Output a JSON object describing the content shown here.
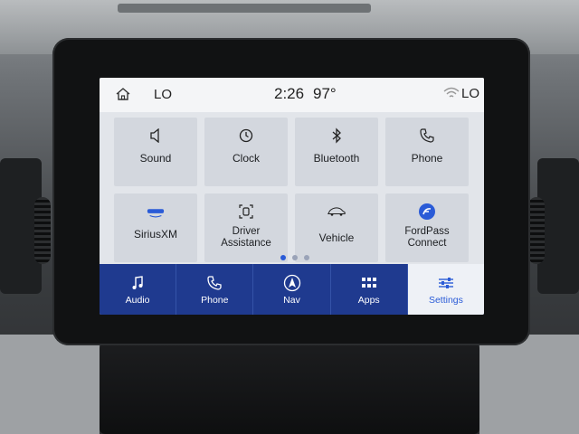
{
  "status": {
    "left_label": "LO",
    "time": "2:26",
    "temperature": "97°",
    "right_label": "LO"
  },
  "tiles": [
    {
      "label": "Sound",
      "icon": "speaker-icon"
    },
    {
      "label": "Clock",
      "icon": "clock-icon"
    },
    {
      "label": "Bluetooth",
      "icon": "bluetooth-icon"
    },
    {
      "label": "Phone",
      "icon": "phone-icon"
    },
    {
      "label": "SiriusXM",
      "icon": "siriusxm-icon"
    },
    {
      "label_line1": "Driver",
      "label_line2": "Assistance",
      "icon": "driver-assist-icon"
    },
    {
      "label": "Vehicle",
      "icon": "car-icon"
    },
    {
      "label_line1": "FordPass",
      "label_line2": "Connect",
      "icon": "fordpass-icon"
    }
  ],
  "page_dots": {
    "count": 3,
    "active": 0
  },
  "nav": [
    {
      "label": "Audio",
      "icon": "music-note-icon"
    },
    {
      "label": "Phone",
      "icon": "phone-icon"
    },
    {
      "label": "Nav",
      "icon": "navigation-arrow-icon"
    },
    {
      "label": "Apps",
      "icon": "grid-apps-icon"
    },
    {
      "label": "Settings",
      "icon": "sliders-icon",
      "active": true
    }
  ],
  "colors": {
    "nav_background": "#1f3a8f",
    "accent": "#2a5bd7",
    "tile_background": "#d3d7de",
    "screen_background": "#e2e5ea"
  }
}
